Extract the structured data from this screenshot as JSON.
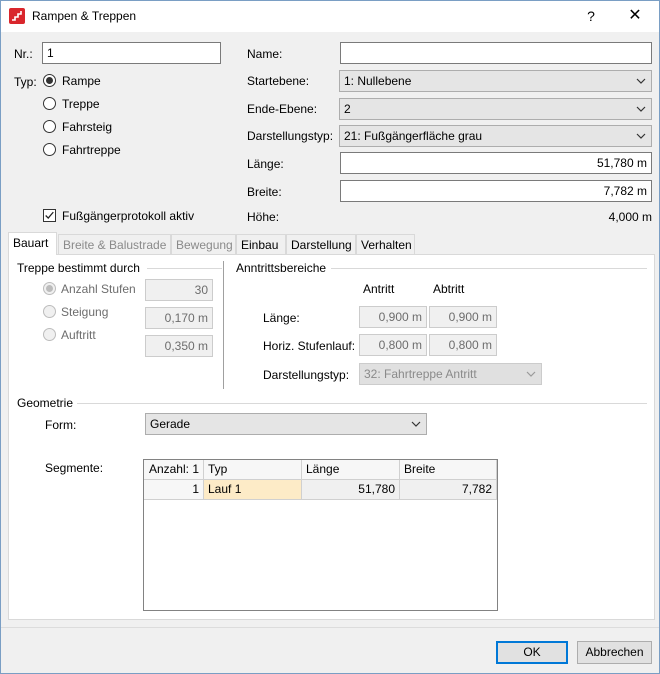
{
  "window": {
    "title": "Rampen & Treppen",
    "help_symbol": "?",
    "close_symbol": "✕"
  },
  "left": {
    "nr_label": "Nr.:",
    "nr_value": "1",
    "typ_label": "Typ:",
    "types": [
      {
        "label": "Rampe",
        "checked": true
      },
      {
        "label": "Treppe",
        "checked": false
      },
      {
        "label": "Fahrsteig",
        "checked": false
      },
      {
        "label": "Fahrtreppe",
        "checked": false
      }
    ],
    "protocol_label": "Fußgängerprotokoll aktiv",
    "protocol_checked": true
  },
  "right": {
    "name_label": "Name:",
    "name_value": "",
    "startebene_label": "Startebene:",
    "startebene_value": "1: Nullebene",
    "endeebene_label": "Ende-Ebene:",
    "endeebene_value": "2",
    "darstellungstyp_label": "Darstellungstyp:",
    "darstellungstyp_value": "21: Fußgängerfläche grau",
    "laenge_label": "Länge:",
    "laenge_value": "51,780 m",
    "breite_label": "Breite:",
    "breite_value": "7,782 m",
    "hoehe_label": "Höhe:",
    "hoehe_value": "4,000 m"
  },
  "tabs": [
    {
      "label": "Bauart",
      "state": "active"
    },
    {
      "label": "Breite & Balustrade",
      "state": "disabled"
    },
    {
      "label": "Bewegung",
      "state": "disabled"
    },
    {
      "label": "Einbau",
      "state": "normal"
    },
    {
      "label": "Darstellung",
      "state": "normal"
    },
    {
      "label": "Verhalten",
      "state": "normal"
    }
  ],
  "bauart": {
    "treppe_group_label": "Treppe bestimmt durch",
    "treppe_options": [
      {
        "label": "Anzahl Stufen",
        "checked": true,
        "value": "30"
      },
      {
        "label": "Steigung",
        "checked": false,
        "value": "0,170 m"
      },
      {
        "label": "Auftritt",
        "checked": false,
        "value": "0,350 m"
      }
    ],
    "anntritt_group_label": "Anntrittsbereiche",
    "col_antritt": "Antritt",
    "col_abtritt": "Abtritt",
    "laenge_label": "Länge:",
    "laenge_antritt": "0,900 m",
    "laenge_abtritt": "0,900 m",
    "horiz_label": "Horiz. Stufenlauf:",
    "horiz_antritt": "0,800 m",
    "horiz_abtritt": "0,800 m",
    "dtyp_label": "Darstellungstyp:",
    "dtyp_value": "32: Fahrtreppe Antritt",
    "geometrie_label": "Geometrie",
    "form_label": "Form:",
    "form_value": "Gerade",
    "segmente_label": "Segmente:",
    "segments_headers": [
      "Anzahl: 1",
      "Typ",
      "Länge",
      "Breite"
    ],
    "segments_rows": [
      [
        "1",
        "Lauf 1",
        "51,780",
        "7,782"
      ]
    ]
  },
  "buttons": {
    "ok": "OK",
    "cancel": "Abbrechen"
  },
  "colors": {
    "accent": "#0078d7",
    "selected_cell": "#fdebc7",
    "app_icon_red": "#d9262c"
  }
}
